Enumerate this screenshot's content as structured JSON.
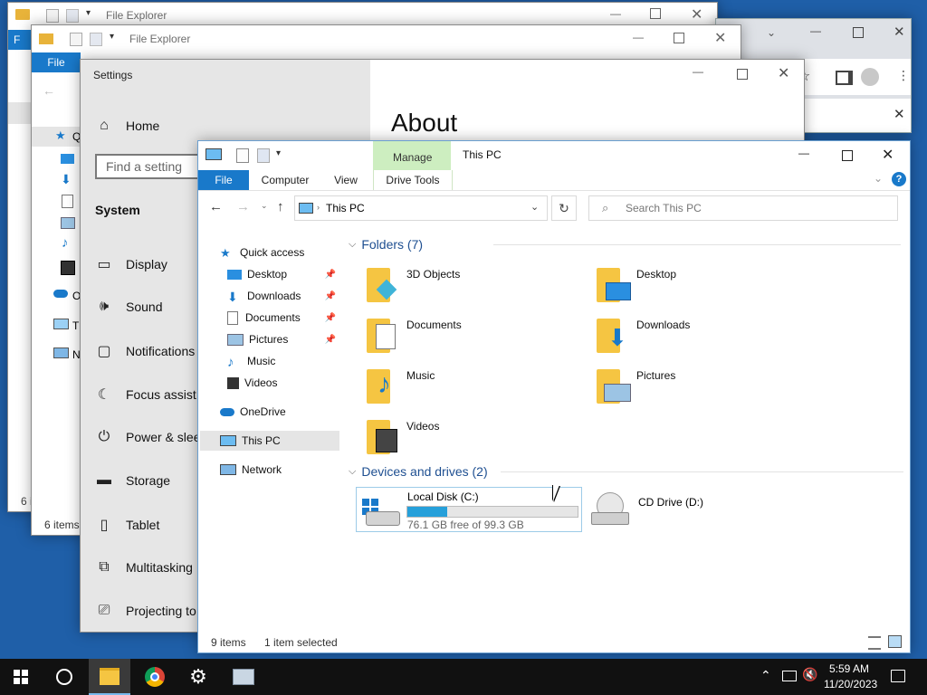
{
  "background_windows": {
    "explorer_back_title": "File Explorer",
    "explorer_mid_title": "File Explorer",
    "explorer_mid_file_tab": "File",
    "explorer_back_file_tab": "F",
    "explorer_mid_status": "6 items",
    "explorer_back_status": "6 i",
    "explorer_mid_nav_quick": "Q",
    "explorer_mid_nav_onedrive": "O",
    "explorer_mid_nav_thispc": "Th",
    "explorer_mid_nav_network": "N"
  },
  "settings": {
    "title": "Settings",
    "home_label": "Home",
    "search_placeholder": "Find a setting",
    "section_label": "System",
    "about_heading": "About",
    "items": [
      {
        "label": "Display"
      },
      {
        "label": "Sound"
      },
      {
        "label": "Notifications"
      },
      {
        "label": "Focus assist"
      },
      {
        "label": "Power & sleep"
      },
      {
        "label": "Storage"
      },
      {
        "label": "Tablet"
      },
      {
        "label": "Multitasking"
      },
      {
        "label": "Projecting to"
      }
    ]
  },
  "explorer": {
    "title": "This PC",
    "manage_tab": "Manage",
    "tabs": {
      "file": "File",
      "computer": "Computer",
      "view": "View",
      "drive_tools": "Drive Tools"
    },
    "address": "This PC",
    "search_placeholder": "Search This PC",
    "nav": {
      "quick_access": "Quick access",
      "desktop": "Desktop",
      "downloads": "Downloads",
      "documents": "Documents",
      "pictures": "Pictures",
      "music": "Music",
      "videos": "Videos",
      "onedrive": "OneDrive",
      "this_pc": "This PC",
      "network": "Network"
    },
    "folders_header": "Folders (7)",
    "folders": [
      {
        "label": "3D Objects"
      },
      {
        "label": "Desktop"
      },
      {
        "label": "Documents"
      },
      {
        "label": "Downloads"
      },
      {
        "label": "Music"
      },
      {
        "label": "Pictures"
      },
      {
        "label": "Videos"
      }
    ],
    "drives_header": "Devices and drives (2)",
    "drives": [
      {
        "label": "Local Disk (C:)",
        "free": "76.1 GB free of 99.3 GB",
        "used_fraction": 0.234
      },
      {
        "label": "CD Drive (D:)"
      }
    ],
    "status_items": "9 items",
    "status_selected": "1 item selected"
  },
  "taskbar": {
    "time": "5:59 AM",
    "date": "11/20/2023"
  },
  "colors": {
    "accent": "#0063b1",
    "ribbon_file": "#1979ca",
    "manage_green": "#cdeec0",
    "folder_yellow": "#f5c542",
    "taskbar": "#111111",
    "drive_bar": "#26a0da"
  }
}
